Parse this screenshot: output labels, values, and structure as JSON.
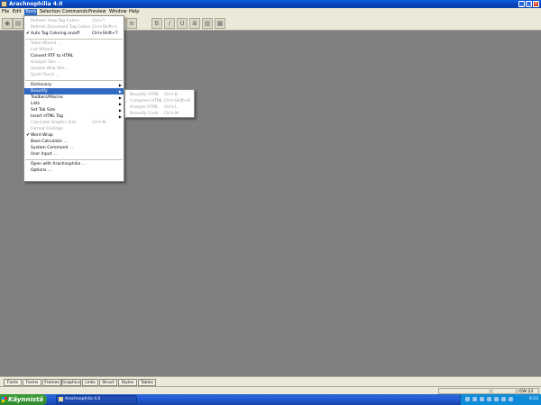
{
  "window": {
    "title": "Arachnophilia 4.0",
    "minimize_glyph": "_",
    "maximize_glyph": "□",
    "close_glyph": "x"
  },
  "menubar": {
    "items": [
      {
        "label": "File"
      },
      {
        "label": "Edit"
      },
      {
        "label": "Tools"
      },
      {
        "label": "Selection"
      },
      {
        "label": "Commands"
      },
      {
        "label": "Preview"
      },
      {
        "label": "Window"
      },
      {
        "label": "Help"
      }
    ],
    "active": "Tools"
  },
  "tools_menu": [
    {
      "label": "Refresh View Tag Colors",
      "shortcut": "Ctrl+T",
      "enabled": false
    },
    {
      "label": "Refresh Document Tag Colors",
      "shortcut": "Ctrl+Shift+L",
      "enabled": false
    },
    {
      "label": "Auto Tag Coloring on/off",
      "shortcut": "Ctrl+Shift+T",
      "enabled": true,
      "checked": true
    },
    {
      "label": "Table Wizard ...",
      "enabled": false
    },
    {
      "label": "List Wizard ...",
      "enabled": false
    },
    {
      "label": "Convert RTF to HTML",
      "enabled": true
    },
    {
      "label": "Analyze Site ...",
      "enabled": false
    },
    {
      "label": "Update Web Site ...",
      "enabled": false
    },
    {
      "label": "Spell Check ...",
      "enabled": false
    },
    {
      "label": "Dictionary",
      "enabled": true,
      "submenu": true
    },
    {
      "label": "Beautify",
      "enabled": true,
      "submenu": true,
      "highlighted": true
    },
    {
      "label": "Toolbars/Macros",
      "enabled": true,
      "submenu": true
    },
    {
      "label": "Lists",
      "enabled": true,
      "submenu": true
    },
    {
      "label": "Set Tab Size",
      "enabled": true,
      "submenu": true
    },
    {
      "label": "Insert HTML Tag",
      "enabled": true,
      "submenu": true
    },
    {
      "label": "Calculate Graphic Size",
      "shortcut": "Ctrl+N",
      "enabled": false
    },
    {
      "label": "Format Findings",
      "enabled": false
    },
    {
      "label": "Word Wrap",
      "enabled": true,
      "checked": true
    },
    {
      "label": "Base Calculator ...",
      "enabled": true
    },
    {
      "label": "System Command ...",
      "enabled": true
    },
    {
      "label": "User Input ...",
      "enabled": true
    },
    {
      "label": "Open with Arachnophilia ...",
      "enabled": true
    },
    {
      "label": "Options ...",
      "enabled": true
    }
  ],
  "beautify_submenu": [
    {
      "label": "Beautify HTML",
      "shortcut": "Ctrl+B",
      "enabled": false
    },
    {
      "label": "Compress HTML",
      "shortcut": "Ctrl+Shift+B",
      "enabled": false
    },
    {
      "label": "Analyze HTML",
      "shortcut": "Ctrl+L",
      "enabled": false
    },
    {
      "label": "Beautify Code",
      "shortcut": "Ctrl+M",
      "enabled": false
    }
  ],
  "doc_tabs": [
    {
      "label": "Fonts"
    },
    {
      "label": "Forms"
    },
    {
      "label": "Frames"
    },
    {
      "label": "Graphics"
    },
    {
      "label": "Links"
    },
    {
      "label": "Struct"
    },
    {
      "label": "Styles"
    },
    {
      "label": "Tables"
    }
  ],
  "status": {
    "right": "OW 23 AM"
  },
  "taskbar": {
    "start_label": "Käynnistä",
    "task_label": "Arachnophilia 4.0",
    "clock": "9:23"
  },
  "colors": {
    "titlebar": "#0a4fd0",
    "menu_highlight": "#316ac5",
    "workspace": "#808080",
    "start_button": "#3c9d3c"
  }
}
